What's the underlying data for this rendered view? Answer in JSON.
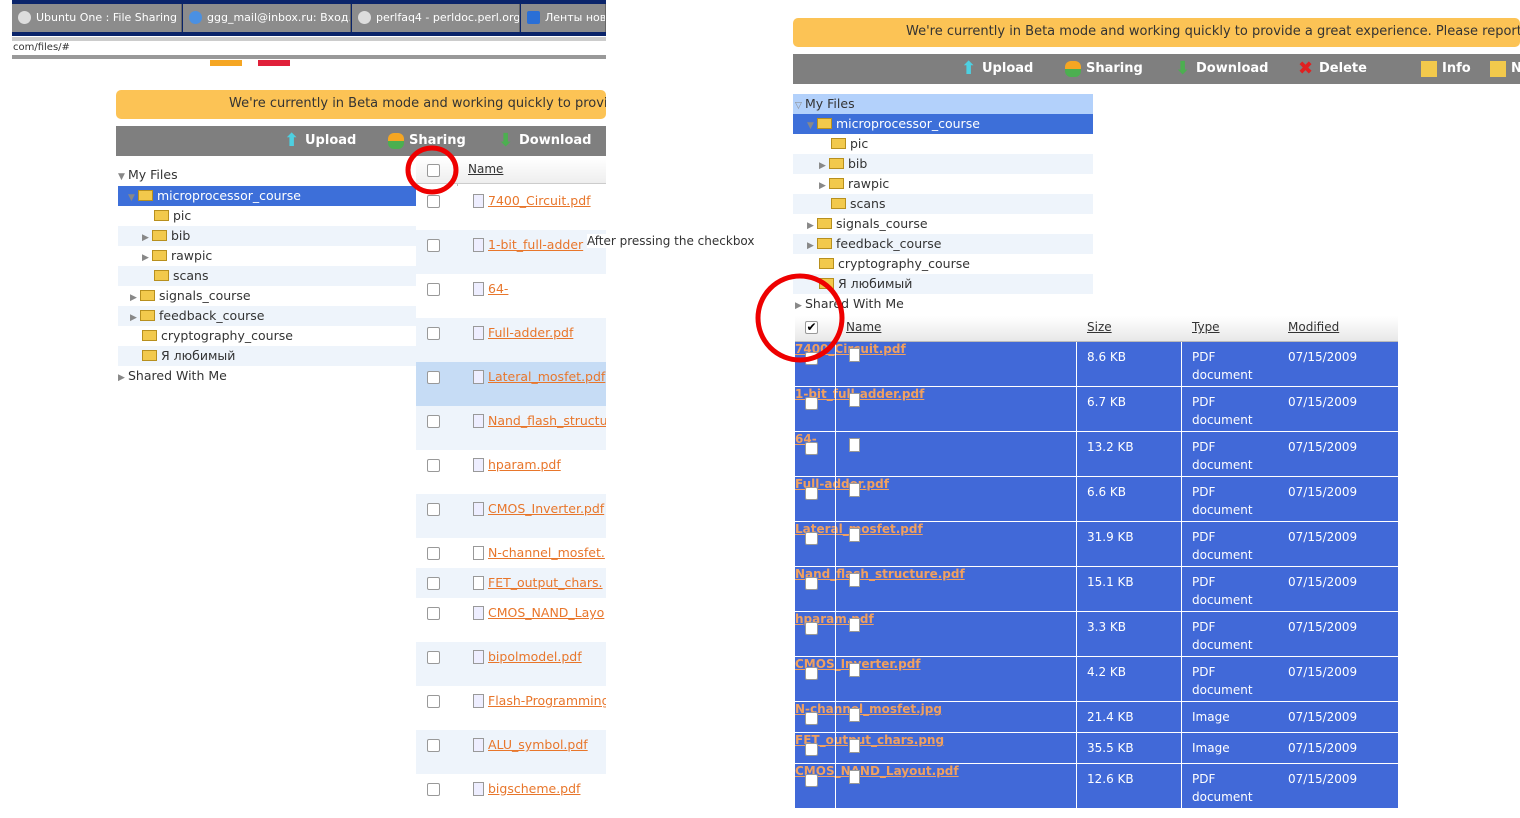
{
  "browser": {
    "tabs": [
      "Ubuntu One : File Sharing",
      "ggg_mail@inbox.ru: Вход...",
      "perlfaq4 - perldoc.perl.org",
      "Ленты новос"
    ],
    "url": "com/files/#"
  },
  "banner_left": "We're currently in Beta mode and working quickly to provide",
  "banner_right": "We're currently in Beta mode and working quickly to provide a great experience. Please report an",
  "toolbar": {
    "upload": "Upload",
    "sharing": "Sharing",
    "download": "Download",
    "delete": "Delete",
    "info": "Info",
    "new": "N"
  },
  "tree": {
    "root": "My Files",
    "items": [
      "microprocessor_course",
      "pic",
      "bib",
      "rawpic",
      "scans",
      "signals_course",
      "feedback_course",
      "cryptography_course",
      "Я любимый"
    ],
    "shared": "Shared With Me"
  },
  "annotation": "After pressing the checkbox",
  "columns": {
    "name": "Name",
    "size": "Size",
    "type": "Type",
    "modified": "Modified"
  },
  "left_files": [
    "7400_Circuit.pdf",
    "1-bit_full-adder",
    "64-",
    "Full-adder.pdf",
    "Lateral_mosfet.pdf",
    "Nand_flash_structu",
    "hparam.pdf",
    "CMOS_Inverter.pdf",
    "N-channel_mosfet.",
    "FET_output_chars.",
    "CMOS_NAND_Layo",
    "bipolmodel.pdf",
    "Flash-Programming",
    "ALU_symbol.pdf",
    "bigscheme.pdf"
  ],
  "right_files": [
    {
      "name": "7400_Circuit.pdf",
      "size": "8.6 KB",
      "type": "PDF document",
      "modified": "07/15/2009"
    },
    {
      "name": "1-bit_full-adder.pdf",
      "size": "6.7 KB",
      "type": "PDF document",
      "modified": "07/15/2009"
    },
    {
      "name": "64-",
      "size": "13.2 KB",
      "type": "PDF document",
      "modified": "07/15/2009"
    },
    {
      "name": "Full-adder.pdf",
      "size": "6.6 KB",
      "type": "PDF document",
      "modified": "07/15/2009"
    },
    {
      "name": "Lateral_mosfet.pdf",
      "size": "31.9 KB",
      "type": "PDF document",
      "modified": "07/15/2009"
    },
    {
      "name": "Nand_flash_structure.pdf",
      "size": "15.1 KB",
      "type": "PDF document",
      "modified": "07/15/2009"
    },
    {
      "name": "hparam.pdf",
      "size": "3.3 KB",
      "type": "PDF document",
      "modified": "07/15/2009"
    },
    {
      "name": "CMOS_Inverter.pdf",
      "size": "4.2 KB",
      "type": "PDF document",
      "modified": "07/15/2009"
    },
    {
      "name": "N-channel_mosfet.jpg",
      "size": "21.4 KB",
      "type": "Image",
      "modified": "07/15/2009"
    },
    {
      "name": "FET_output_chars.png",
      "size": "35.5 KB",
      "type": "Image",
      "modified": "07/15/2009"
    },
    {
      "name": "CMOS_NAND_Layout.pdf",
      "size": "12.6 KB",
      "type": "PDF document",
      "modified": "07/15/2009"
    }
  ]
}
